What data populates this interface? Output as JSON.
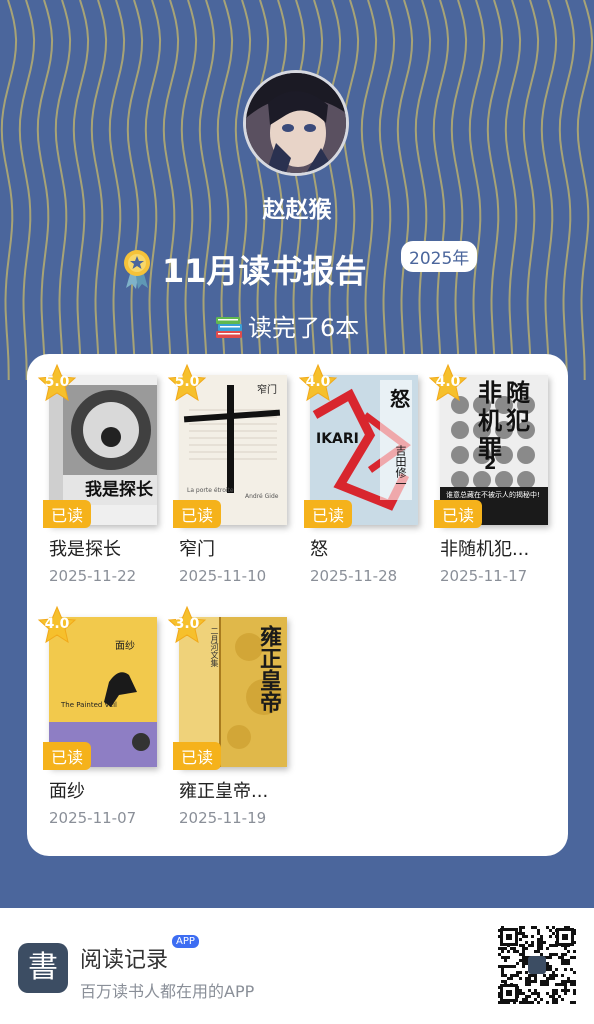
{
  "profile": {
    "username": "赵赵猴",
    "avatar_icon": "avatar-image"
  },
  "report": {
    "title": "11月读书报告",
    "year_badge": "2025年",
    "read_count": "读完了6本",
    "count_icon": "books-icon",
    "medal_icon": "medal-icon"
  },
  "books": [
    {
      "rating": "5.0",
      "tag": "已读",
      "name": "我是探长",
      "date": "2025-11-22"
    },
    {
      "rating": "5.0",
      "tag": "已读",
      "name": "窄门",
      "date": "2025-11-10"
    },
    {
      "rating": "4.0",
      "tag": "已读",
      "name": "怒",
      "date": "2025-11-28"
    },
    {
      "rating": "4.0",
      "tag": "已读",
      "name": "非随机犯...",
      "date": "2025-11-17"
    },
    {
      "rating": "4.0",
      "tag": "已读",
      "name": "面纱",
      "date": "2025-11-07"
    },
    {
      "rating": "3.0",
      "tag": "已读",
      "name": "雍正皇帝...",
      "date": "2025-11-19"
    }
  ],
  "covers": {
    "b1": "我是探长",
    "b2_title": "窄门",
    "b2_sub": "La porte étroite",
    "b2_author": "André Gide",
    "b3_title": "怒",
    "b3_author": "吉田修一",
    "b3_latin": "IKARI",
    "b4_title": "非随机犯罪",
    "b4_num": "2",
    "b4_blurb": "谁意总藏在不被示人的揭秘中!",
    "b5_title": "面纱",
    "b5_en": "The Painted Veil",
    "b6_title": "雍正皇帝",
    "b6_side": "二月河文集"
  },
  "footer": {
    "app_icon": "書",
    "app_name": "阅读记录",
    "app_badge": "APP",
    "slogan": "百万读书人都在用的APP",
    "qr_icon": "qr-code-icon"
  },
  "colors": {
    "background": "#4b669c",
    "accent": "#f5b21b",
    "wave": "#c6b86a"
  }
}
